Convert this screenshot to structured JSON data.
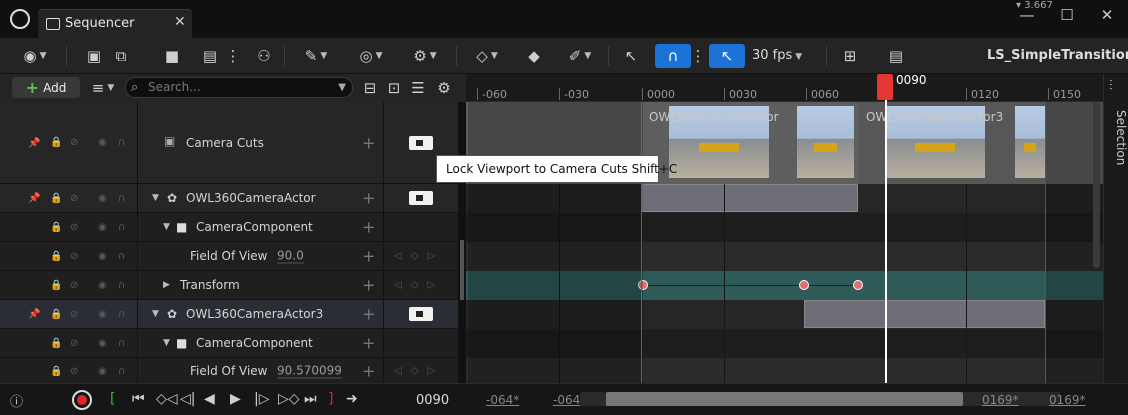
{
  "window": {
    "tab_title": "Sequencer",
    "close": "✕",
    "minimize": "—",
    "maximize": "☐",
    "close_window": "✕"
  },
  "toolbar": {
    "fps": "30 fps",
    "sequence_name": "LS_SimpleTransition"
  },
  "controls": {
    "add_label": "Add",
    "search_placeholder": "Search..."
  },
  "tree": {
    "camera_cuts": "Camera Cuts",
    "actor1": "OWL360CameraActor",
    "camera_component1": "CameraComponent",
    "fov_label1": "Field Of View",
    "fov_value1": "90.0",
    "transform": "Transform",
    "actor2": "OWL360CameraActor3",
    "camera_component2": "CameraComponent",
    "fov_label2": "Field Of View",
    "fov_value2": "90.570099"
  },
  "ruler": {
    "ticks": [
      "-060",
      "-030",
      "0000",
      "0030",
      "0060",
      "0120",
      "0150"
    ],
    "playhead_label": "0090"
  },
  "timeline": {
    "cut1_label": "OWL360CameraActor",
    "cut2_label": "OWL360CameraActor3"
  },
  "tooltip": "Lock Viewport to Camera Cuts Shift+C",
  "bottom": {
    "current_frame": "0090",
    "view_start": "-064*",
    "work_start": "-064*",
    "work_end": "0169*",
    "view_end": "0169*"
  },
  "right_panel": {
    "selection": "Selection"
  },
  "colors": {
    "accent": "#1d72d8",
    "playhead": "#e53535",
    "start": "#3db53d",
    "end": "#c02a2a",
    "transform_track": "#2e5a58"
  }
}
